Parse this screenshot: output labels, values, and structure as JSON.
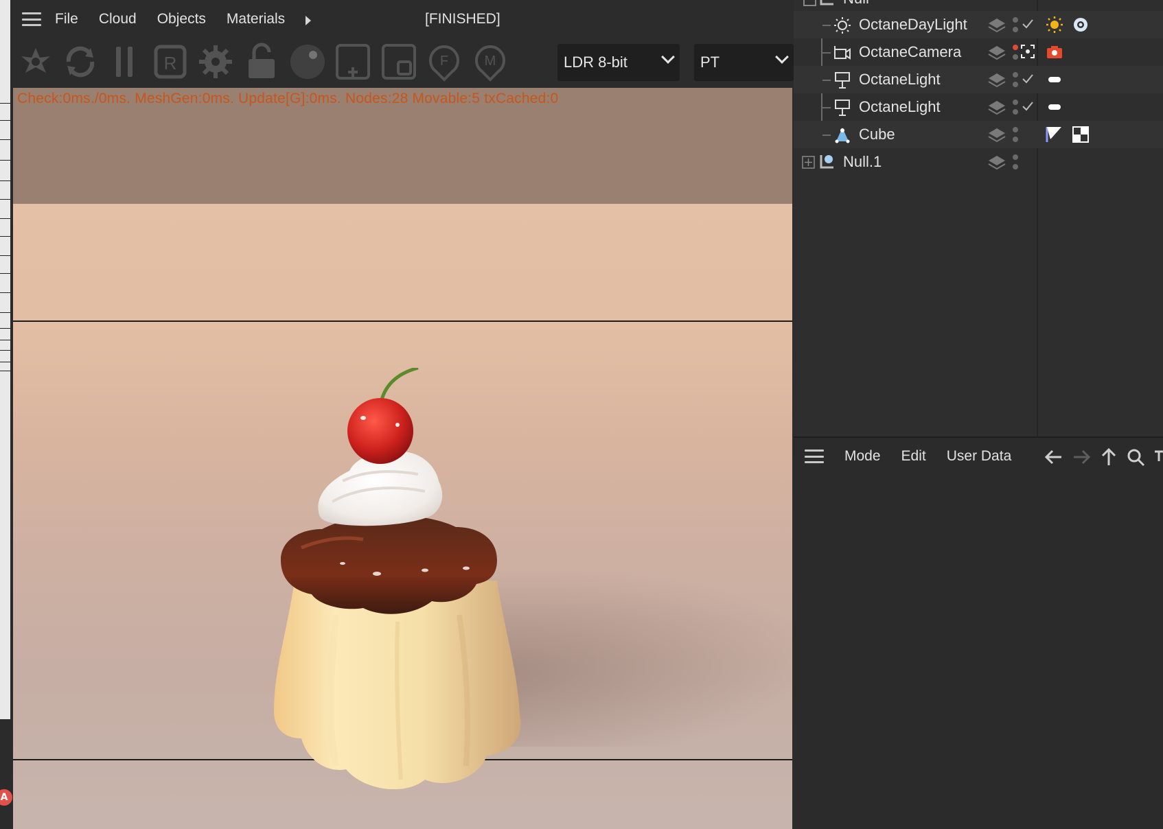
{
  "viewer": {
    "menu": {
      "file": "File",
      "cloud": "Cloud",
      "objects": "Objects",
      "materials": "Materials"
    },
    "render_status": "[FINISHED]",
    "stats_text": "Check:0ms./0ms. MeshGen:0ms. Update[G]:0ms. Nodes:28 Movable:5 txCached:0",
    "toolbar_icons": [
      "send-scene-icon",
      "restart-icon",
      "pause-icon",
      "region-render-icon",
      "settings-gear-icon",
      "lock-icon",
      "material-ball-icon",
      "add-region-icon",
      "film-region-icon",
      "focus-pick-icon",
      "material-pick-icon"
    ],
    "color_depth": {
      "selected": "LDR 8-bit"
    },
    "kernel": {
      "selected": "PT"
    },
    "status_color": "#c7561c"
  },
  "objects": {
    "partial_top_label": "Null",
    "items": [
      {
        "name": "OctaneDayLight",
        "icon": "daylight-icon",
        "tag": "sun-tag-icon",
        "tag2": "settings-tag-icon",
        "checked": true
      },
      {
        "name": "OctaneCamera",
        "icon": "camera-icon",
        "tag": "camera-tag-icon",
        "checked": false
      },
      {
        "name": "OctaneLight",
        "icon": "area-light-icon",
        "tag": "light-tag-icon",
        "checked": true
      },
      {
        "name": "OctaneLight",
        "icon": "area-light-icon",
        "tag": "light-tag-icon",
        "checked": true
      },
      {
        "name": "Cube",
        "icon": "cube-icon",
        "tag": "uv-tag-icon",
        "tag2": "material-tag-icon",
        "checked": false
      },
      {
        "name": "Null.1",
        "icon": "null-icon",
        "checked": false
      }
    ]
  },
  "attributes": {
    "mode": "Mode",
    "edit": "Edit",
    "user_data": "User Data"
  }
}
